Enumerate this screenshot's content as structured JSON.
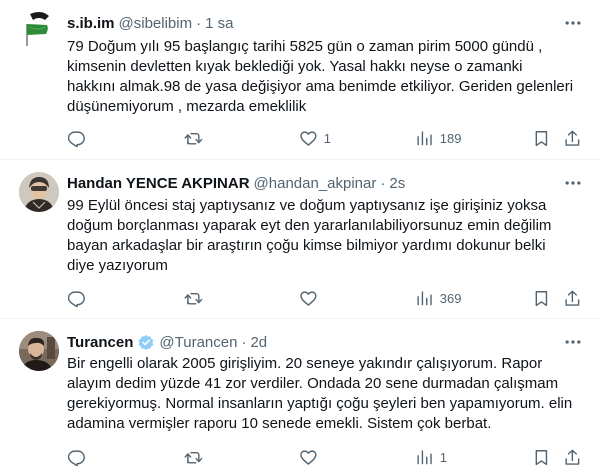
{
  "tweets": [
    {
      "name": "s.ib.im",
      "handle": "@sibelibim",
      "separator": "·",
      "time": "1 sa",
      "text": "79 Doğum yılı 95 başlangıç tarihi 5825 gün o zaman pirim 5000 gündü ,\nkimsenin devletten kıyak beklediği yok. Yasal hakkı neyse o zamanki\nhakkını almak.98 de yasa değişiyor ama benimde etkiliyor. Geriden gelenleri\ndüşünemiyorum , mezarda emeklilik",
      "replies": "",
      "retweets": "",
      "likes": "1",
      "views": "189"
    },
    {
      "name": "Handan YENCE AKPINAR",
      "handle": "@handan_akpinar",
      "separator": "·",
      "time": "2s",
      "text": "99 Eylül  öncesi staj yaptıysanız ve doğum yaptıysanız işe girişiniz yoksa\ndoğum borçlanması yaparak eyt den yararlanılabiliyorsunuz  emin değilim\nbayan arkadaşlar bir araştırın çoğu kimse bilmiyor yardımı dokunur belki\ndiye yazıyorum",
      "replies": "",
      "retweets": "",
      "likes": "",
      "views": "369"
    },
    {
      "name": "Turancen",
      "handle": "@Turancen",
      "separator": "·",
      "time": "2d",
      "text": "Bir engelli olarak 2005 girişliyim. 20 seneye yakındır çalışıyorum. Rapor\nalayım dedim yüzde 41 zor verdiler. Ondada 20 sene durmadan çalışmam\ngerekiyormuş. Normal insanların yaptığı çoğu şeyleri ben yapamıyorum. elin\nadamina vermişler raporu 10 senede emekli. Sistem çok berbat.",
      "replies": "",
      "retweets": "",
      "likes": "",
      "views": "1"
    }
  ],
  "colors": {
    "text_primary": "#0f1419",
    "text_secondary": "#536471",
    "divider": "#eff3f4",
    "verified_badge": "#1d9bf0",
    "flag_green": "#2e8b3a"
  },
  "icons": {
    "more": "more-dots-icon",
    "reply": "reply-icon",
    "retweet": "retweet-icon",
    "like": "heart-icon",
    "views": "views-chart-icon",
    "bookmark": "bookmark-icon",
    "share": "share-icon",
    "verified": "verified-badge-icon"
  }
}
